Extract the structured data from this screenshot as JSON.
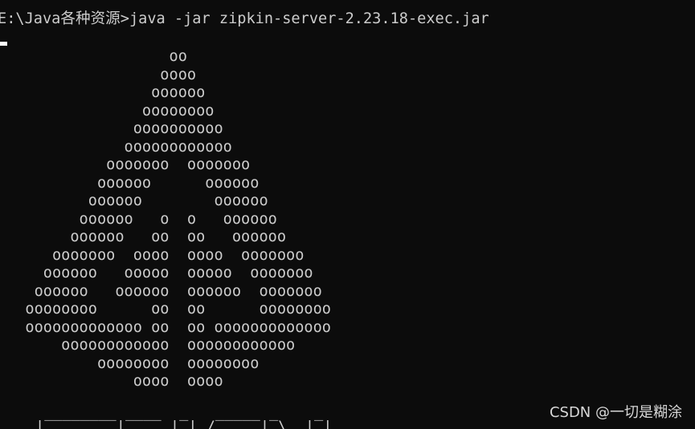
{
  "terminal": {
    "prompt": "E:\\Java各种资源>",
    "command": "java -jar zipkin-server-2.23.18-exec.jar"
  },
  "zipkin_logo": [
    "                  oo",
    "                 oooo",
    "                oooooo",
    "               oooooooo",
    "              oooooooooo",
    "             oooooooooooo",
    "           ooooooo  ooooooo",
    "          oooooo      oooooo",
    "         oooooo        oooooo",
    "        oooooo   o  o   oooooo",
    "       oooooo   oo  oo   oooooo",
    "     ooooooo  oooo  oooo  ooooooo",
    "    oooooo   ooooo  ooooo  ooooooo",
    "   oooooo   oooooo  oooooo  ooooooo",
    "  oooooooo      oo  oo      oooooooo",
    "  ooooooooooooo oo  oo ooooooooooooo",
    "      oooooooooooo  oooooooooooo",
    "          oooooooo  oooooooo",
    "              oooo  oooo"
  ],
  "banner_fragment": "|‾‾‾‾‾‾‾‾|‾‾‾‾ |‾| /‾‾‾‾‾|‾\\  |‾|",
  "watermark": "CSDN @一切是糊涂"
}
